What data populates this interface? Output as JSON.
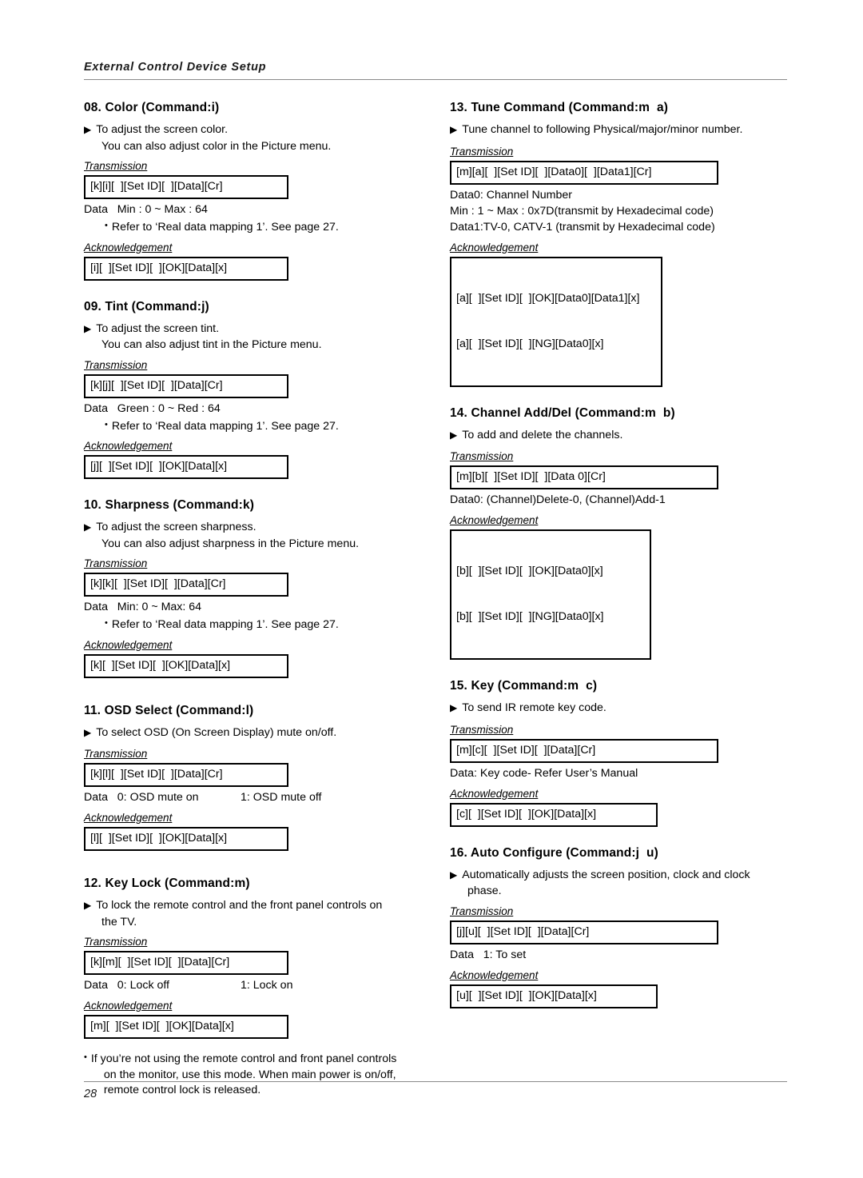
{
  "header": {
    "title": "External Control Device Setup"
  },
  "footer": {
    "page_number": "28"
  },
  "labels": {
    "transmission": "Transmission",
    "acknowledgement": "Acknowledgement"
  },
  "left_column": [
    {
      "id": "sec-08-color",
      "title": "08. Color (Command:i)",
      "desc": "To adjust the screen color.",
      "desc_cont": "You can also adjust color in the Picture menu.",
      "transmission": "[k][i][  ][Set ID][  ][Data][Cr]",
      "data_line": "Data   Min : 0 ~ Max : 64",
      "bullet": "Refer to ‘Real data mapping 1’. See page 27.",
      "acknowledgement": "[i][  ][Set ID][  ][OK][Data][x]"
    },
    {
      "id": "sec-09-tint",
      "title": "09. Tint (Command:j)",
      "desc": "To adjust the screen tint.",
      "desc_cont": "You can also adjust tint in the Picture menu.",
      "transmission": "[k][j][  ][Set ID][  ][Data][Cr]",
      "data_line": "Data   Green : 0 ~ Red : 64",
      "bullet": "Refer to ‘Real data mapping 1’. See page 27.",
      "acknowledgement": "[j][  ][Set ID][  ][OK][Data][x]"
    },
    {
      "id": "sec-10-sharpness",
      "title": "10. Sharpness (Command:k)",
      "desc": "To adjust the screen sharpness.",
      "desc_cont": "You can also adjust sharpness in the Picture menu.",
      "transmission": "[k][k][  ][Set ID][  ][Data][Cr]",
      "data_line": "Data   Min: 0 ~ Max: 64",
      "bullet": "Refer to ‘Real data mapping 1’. See page 27.",
      "acknowledgement": "[k][  ][Set ID][  ][OK][Data][x]"
    },
    {
      "id": "sec-11-osd-select",
      "title": "11. OSD Select (Command:l)",
      "desc": "To select OSD (On Screen Display) mute on/off.",
      "transmission": "[k][l][  ][Set ID][  ][Data][Cr]",
      "data_a": "Data   0: OSD mute on",
      "data_b": "1: OSD mute off",
      "acknowledgement": "[l][  ][Set ID][  ][OK][Data][x]"
    },
    {
      "id": "sec-12-key-lock",
      "title": "12. Key Lock (Command:m)",
      "desc": "To lock the remote control and the front panel controls on",
      "desc_cont": "the TV.",
      "transmission": "[k][m][  ][Set ID][  ][Data][Cr]",
      "data_a": "Data   0: Lock off",
      "data_b": "1: Lock on",
      "acknowledgement": "[m][  ][Set ID][  ][OK][Data][x]",
      "note": "If you’re not using the remote control and front panel controls",
      "note_cont_1": "on the monitor, use this mode. When main power is on/off,",
      "note_cont_2": "remote control lock is released."
    }
  ],
  "right_column": [
    {
      "id": "sec-13-tune-command",
      "title": "13. Tune Command (Command:m  a)",
      "desc": "Tune channel to following Physical/major/minor number.",
      "transmission": "[m][a][  ][Set ID][  ][Data0][  ][Data1][Cr]",
      "data_line_1": "Data0: Channel Number",
      "data_line_2": "Min : 1 ~ Max : 0x7D(transmit by Hexadecimal code)",
      "data_line_3": "Data1:TV-0, CATV-1 (transmit by Hexadecimal code)",
      "ack_line_1": "[a][  ][Set ID][  ][OK][Data0][Data1][x]",
      "ack_line_2": "[a][  ][Set ID][  ][NG][Data0][x]"
    },
    {
      "id": "sec-14-channel-add-del",
      "title": "14. Channel Add/Del (Command:m  b)",
      "desc": "To add and delete the channels.",
      "transmission": "[m][b][  ][Set ID][  ][Data 0][Cr]",
      "data_line_1": "Data0: (Channel)Delete-0, (Channel)Add-1",
      "ack_line_1": "[b][  ][Set ID][  ][OK][Data0][x]",
      "ack_line_2": "[b][  ][Set ID][  ][NG][Data0][x]"
    },
    {
      "id": "sec-15-key",
      "title": "15. Key (Command:m  c)",
      "desc": "To send IR remote key code.",
      "transmission": "[m][c][  ][Set ID][  ][Data][Cr]",
      "data_line_1": "Data: Key code- Refer User’s Manual",
      "ack_line_1": "[c][  ][Set ID][  ][OK][Data][x]"
    },
    {
      "id": "sec-16-auto-configure",
      "title": "16. Auto Configure (Command:j  u)",
      "desc": "Automatically adjusts the screen position, clock and clock",
      "desc_cont": "phase.",
      "transmission": "[j][u][  ][Set ID][  ][Data][Cr]",
      "data_line_1": "Data   1: To set",
      "ack_line_1": "[u][  ][Set ID][  ][OK][Data][x]"
    }
  ],
  "icons": {
    "triangle": "▶",
    "dot": "●"
  }
}
